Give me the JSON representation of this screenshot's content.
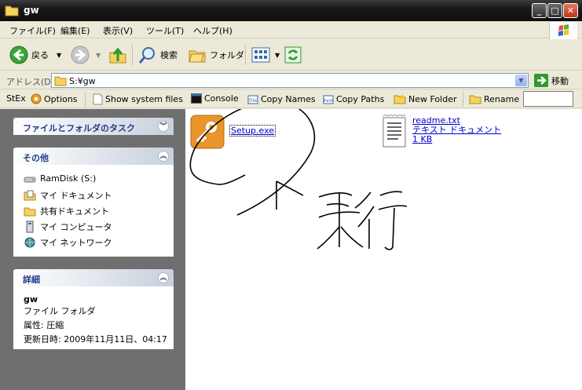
{
  "window": {
    "title": "gw"
  },
  "menu": [
    "ファイル(F)",
    "編集(E)",
    "表示(V)",
    "ツール(T)",
    "ヘルプ(H)"
  ],
  "toolbar": {
    "back": "戻る",
    "search": "検索",
    "folders": "フォルダ"
  },
  "address": {
    "label": "アドレス(D)",
    "value": "S:¥gw",
    "go": "移動"
  },
  "stex": {
    "label": "StEx",
    "options": "Options",
    "show_system": "Show system files",
    "console": "Console",
    "copy_names": "Copy Names",
    "copy_paths": "Copy Paths",
    "new_folder": "New Folder",
    "rename": "Rename"
  },
  "left": {
    "tasks_header": "ファイルとフォルダのタスク",
    "other_header": "その他",
    "other_items": [
      "RamDisk (S:)",
      "マイ ドキュメント",
      "共有ドキュメント",
      "マイ コンピュータ",
      "マイ ネットワーク"
    ],
    "details_header": "詳細",
    "details": {
      "name": "gw",
      "type": "ファイル フォルダ",
      "attr": "属性: 圧縮",
      "date": "更新日時: 2009年11月11日、04:17"
    }
  },
  "files": [
    {
      "name": "Setup.exe"
    },
    {
      "name": "readme.txt",
      "type": "テキスト ドキュメント",
      "size": "1 KB"
    }
  ],
  "annotation": {
    "handwritten": "実行"
  },
  "colors": {
    "link": "#0000cc",
    "left_pane": "#6f6f6f",
    "title_bar": "#1a1a1a"
  }
}
